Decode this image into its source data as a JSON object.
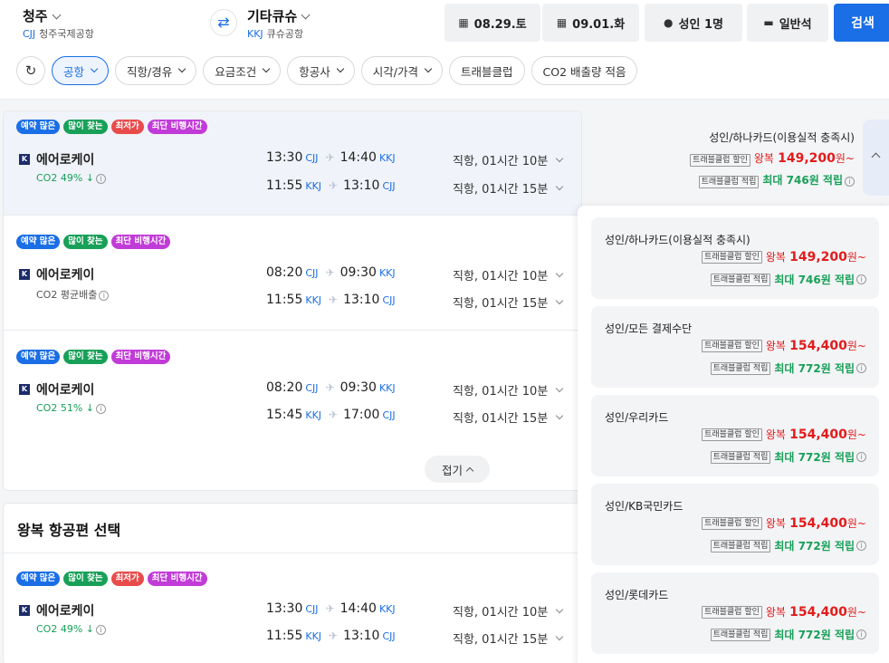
{
  "header": {
    "origin_city": "청주",
    "origin_code": "CJJ",
    "origin_airport": "청주국제공항",
    "dest_city": "기타큐슈",
    "dest_code": "KKJ",
    "dest_airport": "큐슈공항",
    "date_out": "08.29.토",
    "date_in": "09.01.화",
    "passengers": "성인 1명",
    "cabin": "일반석",
    "search_label": "검색"
  },
  "filters": [
    "공항",
    "직항/경유",
    "요금조건",
    "항공사",
    "시각/가격",
    "트래블클럽",
    "CO2 배출량 적음"
  ],
  "icons": {
    "reload": "↻",
    "swap": "⇄",
    "calendar": "📅",
    "person": "👤",
    "seat": "💺",
    "plane": "✈",
    "airline_logo": "K"
  },
  "colors": {
    "accent": "#1a6ee6",
    "price_red": "#e21b1b",
    "points_green": "#18a058",
    "badge_purple": "#c13bd8"
  },
  "flights": [
    {
      "badges": [
        "예약 많은",
        "많이 찾는",
        "최저가",
        "최단 비행시간"
      ],
      "airline": "에어로케이",
      "co2": "CO2 49% ↓",
      "out": {
        "dep": "13:30",
        "dep_ap": "CJJ",
        "arr": "14:40",
        "arr_ap": "KKJ",
        "dur": "직항, 01시간 10분"
      },
      "ret": {
        "dep": "11:55",
        "dep_ap": "KKJ",
        "arr": "13:10",
        "arr_ap": "CJJ",
        "dur": "직항, 01시간 15분"
      }
    },
    {
      "badges": [
        "예약 많은",
        "많이 찾는",
        "최단 비행시간"
      ],
      "airline": "에어로케이",
      "co2": "CO2 평균배출",
      "out": {
        "dep": "08:20",
        "dep_ap": "CJJ",
        "arr": "09:30",
        "arr_ap": "KKJ",
        "dur": "직항, 01시간 10분"
      },
      "ret": {
        "dep": "11:55",
        "dep_ap": "KKJ",
        "arr": "13:10",
        "arr_ap": "CJJ",
        "dur": "직항, 01시간 15분"
      }
    },
    {
      "badges": [
        "예약 많은",
        "많이 찾는",
        "최단 비행시간"
      ],
      "airline": "에어로케이",
      "co2": "CO2 51% ↓",
      "out": {
        "dep": "08:20",
        "dep_ap": "CJJ",
        "arr": "09:30",
        "arr_ap": "KKJ",
        "dur": "직항, 01시간 10분"
      },
      "ret": {
        "dep": "15:45",
        "dep_ap": "KKJ",
        "arr": "17:00",
        "arr_ap": "CJJ",
        "dur": "직항, 01시간 15분"
      }
    }
  ],
  "fold_label": "접기",
  "section_title": "왕복 항공편 선택",
  "section_flight": {
    "badges": [
      "예약 많은",
      "많이 찾는",
      "최저가",
      "최단 비행시간"
    ],
    "airline": "에어로케이",
    "co2": "CO2 49% ↓",
    "out": {
      "dep": "13:30",
      "dep_ap": "CJJ",
      "arr": "14:40",
      "arr_ap": "KKJ",
      "dur": "직항, 01시간 10분"
    },
    "ret": {
      "dep": "11:55",
      "dep_ap": "KKJ",
      "arr": "13:10",
      "arr_ap": "CJJ",
      "dur": "직항, 01시간 15분"
    }
  },
  "top_price": {
    "name": "성인/하나카드(이용실적 충족시)",
    "discount_tag": "트래블클럽 할인",
    "roundtrip": "왕복",
    "price": "149,200",
    "won": "원~",
    "points_tag": "트래블클럽 적립",
    "points": "최대 746원 적립"
  },
  "price_options": [
    {
      "name": "성인/하나카드(이용실적 충족시)",
      "price": "149,200",
      "points": "최대 746원 적립"
    },
    {
      "name": "성인/모든 결제수단",
      "price": "154,400",
      "points": "최대 772원 적립"
    },
    {
      "name": "성인/우리카드",
      "price": "154,400",
      "points": "최대 772원 적립"
    },
    {
      "name": "성인/KB국민카드",
      "price": "154,400",
      "points": "최대 772원 적립"
    },
    {
      "name": "성인/롯데카드",
      "price": "154,400",
      "points": "최대 772원 적립"
    }
  ],
  "tag_labels": {
    "discount": "트래블클럽 할인",
    "points": "트래블클럽 적립",
    "roundtrip": "왕복",
    "won": "원~"
  }
}
